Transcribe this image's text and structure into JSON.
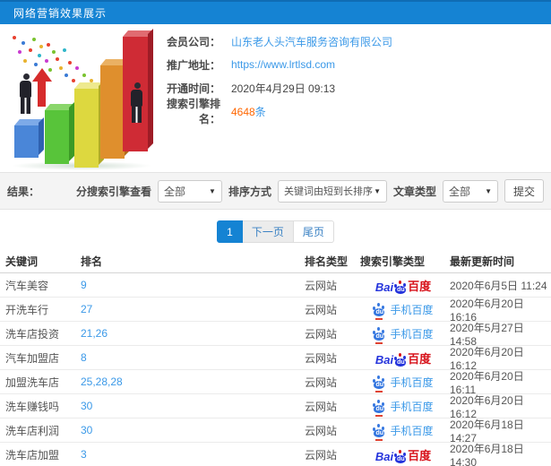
{
  "header": {
    "title": "网络营销效果展示"
  },
  "company_info": {
    "fields": [
      {
        "label": "会员公司：",
        "value": "山东老人头汽车服务咨询有限公司"
      },
      {
        "label": "推广地址：",
        "value": "https://www.lrtlsd.com"
      },
      {
        "label": "开通时间：",
        "value": "2020年4月29日 09:13"
      },
      {
        "label": "搜索引擎排名：",
        "value": "4648",
        "suffix": "条"
      }
    ]
  },
  "illustration": {
    "description": "3d-bar-chart-with-businessmen-and-confetti",
    "bar_colors": [
      "#4a86d8",
      "#58c43a",
      "#ddd83f",
      "#df8f2d",
      "#cf2b35"
    ]
  },
  "filter_bar": {
    "result_label": "结果：",
    "filters": [
      {
        "label": "分搜索引擎查看",
        "value": "全部"
      },
      {
        "label": "排序方式",
        "value": "关键词由短到长排序"
      },
      {
        "label": "文章类型",
        "value": "全部"
      }
    ],
    "submit_label": "提交"
  },
  "pagination": {
    "current": "1",
    "next": "下一页",
    "last": "尾页"
  },
  "table": {
    "headers": [
      "关键词",
      "排名",
      "排名类型",
      "搜索引擎类型",
      "最新更新时间"
    ],
    "engine_labels": {
      "baidu_bai": "Bai",
      "baidu_du": "du",
      "baidu_cn": "百度",
      "mobile": "手机百度"
    },
    "rows": [
      {
        "keyword": "汽车美容",
        "rank": "9",
        "rank_type": "云网站",
        "engine": "baidu",
        "updated": "2020年6月5日 11:24"
      },
      {
        "keyword": "开洗车行",
        "rank": "27",
        "rank_type": "云网站",
        "engine": "mobile-baidu",
        "updated": "2020年6月20日 16:16"
      },
      {
        "keyword": "洗车店投资",
        "rank": "21,26",
        "rank_type": "云网站",
        "engine": "mobile-baidu",
        "updated": "2020年5月27日 14:58"
      },
      {
        "keyword": "汽车加盟店",
        "rank": "8",
        "rank_type": "云网站",
        "engine": "baidu",
        "updated": "2020年6月20日 16:12"
      },
      {
        "keyword": "加盟洗车店",
        "rank": "25,28,28",
        "rank_type": "云网站",
        "engine": "mobile-baidu",
        "updated": "2020年6月20日 16:11"
      },
      {
        "keyword": "洗车赚钱吗",
        "rank": "30",
        "rank_type": "云网站",
        "engine": "mobile-baidu",
        "updated": "2020年6月20日 16:12"
      },
      {
        "keyword": "洗车店利润",
        "rank": "30",
        "rank_type": "云网站",
        "engine": "mobile-baidu",
        "updated": "2020年6月18日 14:27"
      },
      {
        "keyword": "洗车店加盟",
        "rank": "3",
        "rank_type": "云网站",
        "engine": "baidu",
        "updated": "2020年6月18日 14:30"
      }
    ]
  },
  "colors": {
    "header_bg": "#1583d3",
    "link_blue": "#3b99e8",
    "highlight_orange": "#ff6600",
    "baidu_blue": "#2534dc",
    "baidu_red": "#d7121a"
  }
}
